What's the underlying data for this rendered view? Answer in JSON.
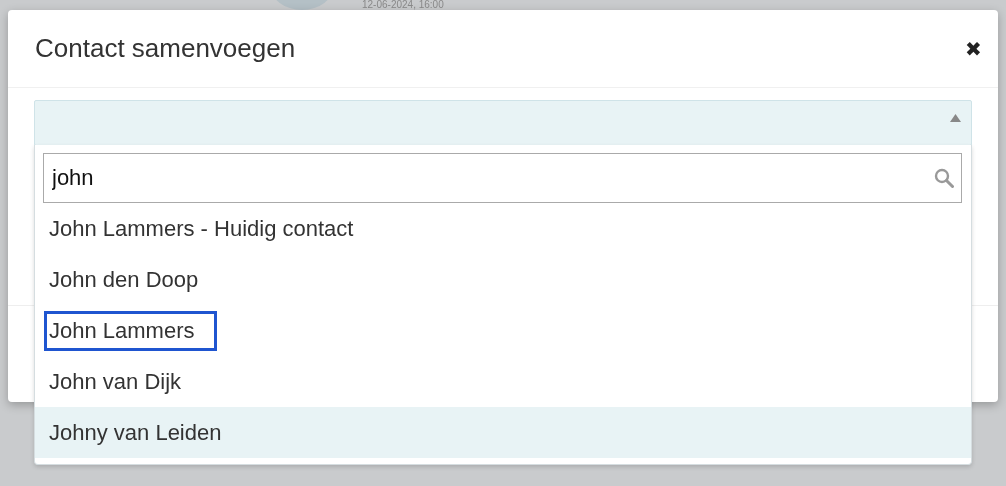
{
  "background": {
    "timestamp": "12-06-2024, 16:00"
  },
  "dialog": {
    "title": "Contact samenvoegen",
    "close_icon": "✖"
  },
  "select": {
    "expanded": true,
    "search": {
      "value": "john"
    },
    "options": [
      {
        "label": "John Lammers - Huidig contact",
        "highlighted": false,
        "focused": false
      },
      {
        "label": "John den Doop",
        "highlighted": false,
        "focused": false
      },
      {
        "label": "John Lammers",
        "highlighted": false,
        "focused": true
      },
      {
        "label": "John van Dijk",
        "highlighted": false,
        "focused": false
      },
      {
        "label": "Johny van Leiden",
        "highlighted": true,
        "focused": false
      }
    ]
  }
}
